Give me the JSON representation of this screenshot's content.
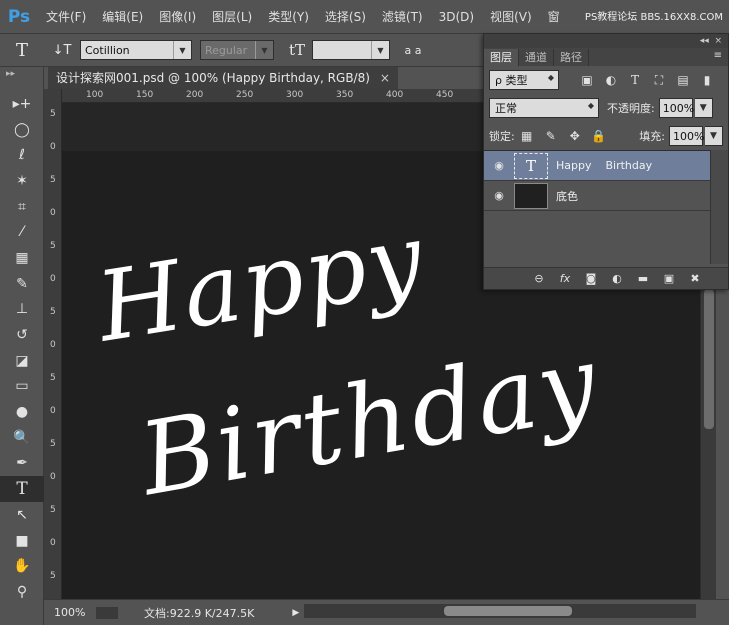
{
  "app": {
    "logo": "Ps"
  },
  "menu": [
    "文件(F)",
    "编辑(E)",
    "图像(I)",
    "图层(L)",
    "类型(Y)",
    "选择(S)",
    "滤镜(T)",
    "3D(D)",
    "视图(V)",
    "窗"
  ],
  "watermark": "PS教程论坛 BBS.16XX8.COM",
  "options": {
    "tool_glyph": "T",
    "orient_glyph": "↓T",
    "font_family": "Cotillion",
    "font_style": "Regular",
    "size_glyph": "tT",
    "size_value": "",
    "aa_glyph": "a a"
  },
  "document": {
    "tab_title": "设计探索网001.psd @ 100% (Happy    Birthday, RGB/8)",
    "close": "×",
    "ruler_h_ticks": [
      "100",
      "150",
      "200",
      "250",
      "300",
      "350",
      "400",
      "450"
    ],
    "ruler_v_ticks": [
      "5",
      "0",
      "5",
      "0",
      "5",
      "0",
      "5",
      "0",
      "5",
      "0",
      "5",
      "0",
      "5",
      "0",
      "5",
      "0"
    ],
    "canvas_line1": "Happy",
    "canvas_line2": "Birthday"
  },
  "status": {
    "zoom": "100%",
    "doc": "文档:922.9 K/247.5K",
    "play": "▶"
  },
  "layers_panel": {
    "tabs": [
      "图层",
      "通道",
      "路径"
    ],
    "filter_label": "ρ 类型",
    "blend_mode": "正常",
    "opacity_label": "不透明度:",
    "opacity_value": "100%",
    "lock_label": "锁定:",
    "fill_label": "填充:",
    "fill_value": "100%",
    "layers": [
      {
        "name": "Happy    Birthday",
        "thumb": "T",
        "selected": true
      },
      {
        "name": "底色",
        "selected": false
      }
    ],
    "bottom_icons": [
      "GO",
      "fx",
      "◙",
      "◐",
      "▬",
      "▣",
      "🗑"
    ]
  },
  "colors": {
    "accent": "#3fa0e8",
    "selection": "#6f7f9b",
    "canvas": "#1f1f1f"
  }
}
